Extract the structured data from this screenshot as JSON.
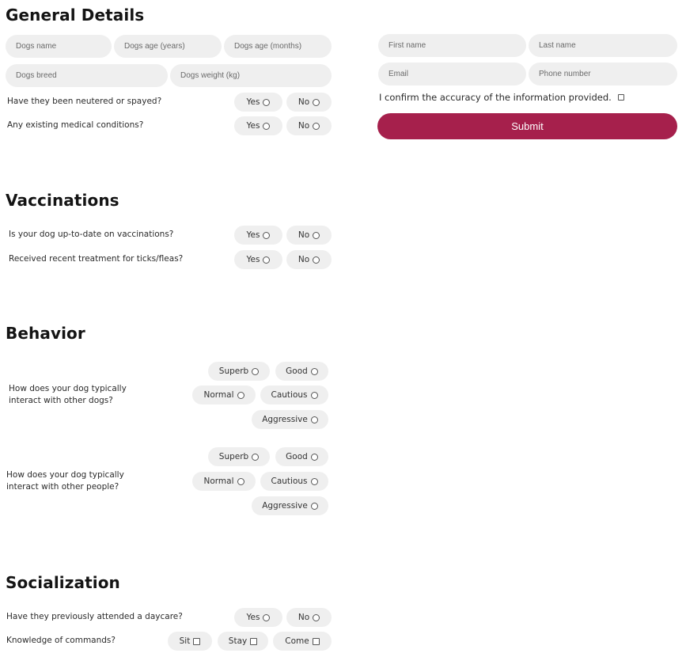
{
  "colors": {
    "accent": "#a6204c",
    "field_bg": "#efefef"
  },
  "general": {
    "heading": "General Details",
    "fields": {
      "dogs_name": "Dogs name",
      "dogs_age_years": "Dogs age (years)",
      "dogs_age_months": "Dogs age (months)",
      "dogs_breed": "Dogs breed",
      "dogs_weight": "Dogs weight (kg)"
    },
    "neutered_q": "Have they been neutered or spayed?",
    "medical_q": "Any existing medical conditions?"
  },
  "contact": {
    "first_name": "First name",
    "last_name": "Last name",
    "email": "Email",
    "phone": "Phone number",
    "confirm": "I confirm the accuracy of the information provided.",
    "submit": "Submit"
  },
  "options": {
    "yes": "Yes",
    "no": "No",
    "superb": "Superb",
    "good": "Good",
    "normal": "Normal",
    "cautious": "Cautious",
    "aggressive": "Aggressive",
    "sit": "Sit",
    "stay": "Stay",
    "come": "Come"
  },
  "vaccinations": {
    "heading": "Vaccinations",
    "q1": "Is your dog up-to-date on vaccinations?",
    "q2": "Received recent treatment for ticks/fleas?"
  },
  "behavior": {
    "heading": "Behavior",
    "q1": "How does your dog typically interact with other dogs?",
    "q2": "How does your dog typically interact with other people?"
  },
  "socialization": {
    "heading": "Socialization",
    "q1": "Have they previously attended a daycare?",
    "q2": "Knowledge of commands?"
  }
}
